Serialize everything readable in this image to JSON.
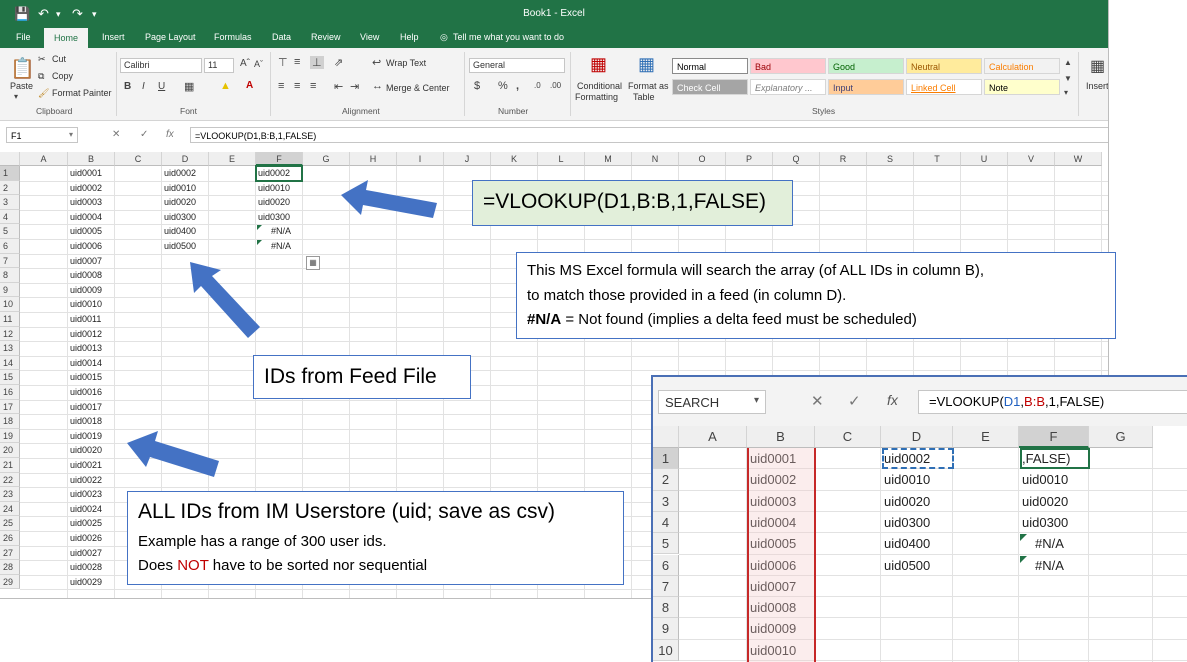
{
  "excel": {
    "title": "Book1  -  Excel",
    "tabs": [
      "File",
      "Home",
      "Insert",
      "Page Layout",
      "Formulas",
      "Data",
      "Review",
      "View",
      "Help"
    ],
    "tell_me": "Tell me what you want to do",
    "clipboard": {
      "paste": "Paste",
      "cut": "Cut",
      "copy": "Copy",
      "format_painter": "Format Painter",
      "label": "Clipboard"
    },
    "font": {
      "name": "Calibri",
      "size": "11",
      "label": "Font"
    },
    "alignment": {
      "wrap_text": "Wrap Text",
      "merge_center": "Merge & Center",
      "label": "Alignment"
    },
    "number": {
      "format": "General",
      "label": "Number"
    },
    "styles_group": {
      "conditional": "Conditional",
      "conditional2": "Formatting",
      "format_as": "Format as",
      "format_as2": "Table",
      "label": "Styles",
      "items": [
        {
          "label": "Normal",
          "bg": "#ffffff",
          "fg": "#000000"
        },
        {
          "label": "Bad",
          "bg": "#ffc7ce",
          "fg": "#9c0006"
        },
        {
          "label": "Good",
          "bg": "#c6efce",
          "fg": "#006100"
        },
        {
          "label": "Neutral",
          "bg": "#ffeb9c",
          "fg": "#9c5700"
        },
        {
          "label": "Calculation",
          "bg": "#f2f2f2",
          "fg": "#fa7d00"
        },
        {
          "label": "Check Cell",
          "bg": "#a5a5a5",
          "fg": "#ffffff"
        },
        {
          "label": "Explanatory ...",
          "bg": "#ffffff",
          "fg": "#7f7f7f"
        },
        {
          "label": "Input",
          "bg": "#ffcc99",
          "fg": "#3f3f76"
        },
        {
          "label": "Linked Cell",
          "bg": "#ffffff",
          "fg": "#fa7d00"
        },
        {
          "label": "Note",
          "bg": "#ffffcc",
          "fg": "#000000"
        }
      ]
    },
    "insert_label": "Insert",
    "name_box": "F1",
    "formula": "=VLOOKUP(D1,B:B,1,FALSE)",
    "columns": [
      "A",
      "B",
      "C",
      "D",
      "E",
      "F",
      "G",
      "H",
      "I",
      "J",
      "K",
      "L",
      "M",
      "N",
      "O",
      "P",
      "Q",
      "R",
      "S",
      "T",
      "U",
      "V",
      "W"
    ],
    "rows": [
      "1",
      "2",
      "3",
      "4",
      "5",
      "6",
      "7",
      "8",
      "9",
      "10",
      "11",
      "12",
      "13",
      "14",
      "15",
      "16",
      "17",
      "18",
      "19",
      "20",
      "21",
      "22",
      "23",
      "24",
      "25",
      "26",
      "27",
      "28",
      "29"
    ],
    "col_b": [
      "uid0001",
      "uid0002",
      "uid0003",
      "uid0004",
      "uid0005",
      "uid0006",
      "uid0007",
      "uid0008",
      "uid0009",
      "uid0010",
      "uid0011",
      "uid0012",
      "uid0013",
      "uid0014",
      "uid0015",
      "uid0016",
      "uid0017",
      "uid0018",
      "uid0019",
      "uid0020",
      "uid0021",
      "uid0022",
      "uid0023",
      "uid0024",
      "uid0025",
      "uid0026",
      "uid0027",
      "uid0028",
      "uid0029"
    ],
    "col_d": [
      "uid0002",
      "uid0010",
      "uid0020",
      "uid0300",
      "uid0400",
      "uid0500"
    ],
    "col_f": [
      "uid0002",
      "uid0010",
      "uid0020",
      "uid0300",
      "#N/A",
      "#N/A"
    ]
  },
  "callouts": {
    "formula": "=VLOOKUP(D1,B:B,1,FALSE)",
    "desc_line1": "This MS Excel formula will search the array (of ALL IDs in column B),",
    "desc_line2": "to match those provided in a feed (in column D).",
    "desc_line3_bold": "#N/A",
    "desc_line3_rest": " = Not found (implies a delta feed must be scheduled)",
    "feed": "IDs from Feed File",
    "all_title": "ALL IDs from IM Userstore (uid; save as csv)",
    "all_line1": "Example has a range of 300 user ids.",
    "all_line2_a": "Does ",
    "all_line2_not": "NOT",
    "all_line2_b": " have to be sorted nor sequential"
  },
  "zoom": {
    "name_box": "SEARCH",
    "formula_prefix": "=VLOOKUP(",
    "formula_d1": "D1",
    "formula_comma": ",",
    "formula_bb": "B:B",
    "formula_suffix": ",1,FALSE)",
    "columns": [
      "A",
      "B",
      "C",
      "D",
      "E",
      "F",
      "G"
    ],
    "rows": [
      "1",
      "2",
      "3",
      "4",
      "5",
      "6",
      "7",
      "8",
      "9",
      "10"
    ],
    "col_b": [
      "uid0001",
      "uid0002",
      "uid0003",
      "uid0004",
      "uid0005",
      "uid0006",
      "uid0007",
      "uid0008",
      "uid0009",
      "uid0010"
    ],
    "col_d": [
      "uid0002",
      "uid0010",
      "uid0020",
      "uid0300",
      "uid0400",
      "uid0500"
    ],
    "col_f": [
      ",FALSE)",
      "uid0010",
      "uid0020",
      "uid0300",
      "#N/A",
      "#N/A"
    ]
  },
  "colors": {
    "excel_green": "#217346",
    "callout_border": "#4472c4",
    "arrow": "#4472c4",
    "not_red": "#c00000"
  }
}
